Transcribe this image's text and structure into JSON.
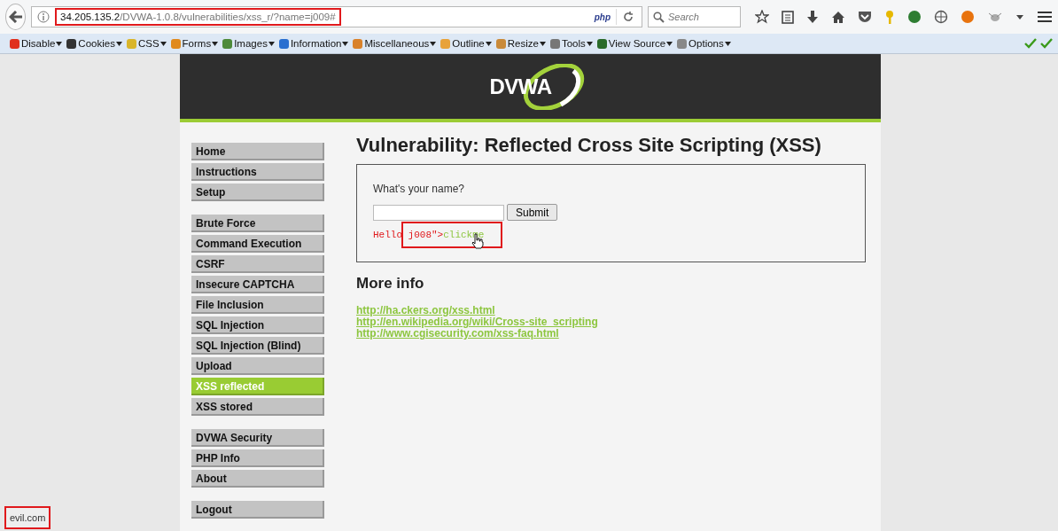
{
  "browser": {
    "url": {
      "host": "34.205.135.2",
      "path": "/DVWA-1.0.8/vulnerabilities/xss_r/?name=j009#",
      "highlighted": true
    },
    "php_badge": "php",
    "search": {
      "placeholder": "Search"
    }
  },
  "devbar": {
    "items": [
      {
        "label": "Disable"
      },
      {
        "label": "Cookies"
      },
      {
        "label": "CSS"
      },
      {
        "label": "Forms"
      },
      {
        "label": "Images"
      },
      {
        "label": "Information"
      },
      {
        "label": "Miscellaneous"
      },
      {
        "label": "Outline"
      },
      {
        "label": "Resize"
      },
      {
        "label": "Tools"
      },
      {
        "label": "View Source"
      },
      {
        "label": "Options"
      }
    ]
  },
  "header": {
    "logo": "DVWA"
  },
  "menu": {
    "groups": [
      [
        {
          "label": "Home",
          "selected": false
        },
        {
          "label": "Instructions",
          "selected": false
        },
        {
          "label": "Setup",
          "selected": false
        }
      ],
      [
        {
          "label": "Brute Force",
          "selected": false
        },
        {
          "label": "Command Execution",
          "selected": false
        },
        {
          "label": "CSRF",
          "selected": false
        },
        {
          "label": "Insecure CAPTCHA",
          "selected": false
        },
        {
          "label": "File Inclusion",
          "selected": false
        },
        {
          "label": "SQL Injection",
          "selected": false
        },
        {
          "label": "SQL Injection (Blind)",
          "selected": false
        },
        {
          "label": "Upload",
          "selected": false
        },
        {
          "label": "XSS reflected",
          "selected": true
        },
        {
          "label": "XSS stored",
          "selected": false
        }
      ],
      [
        {
          "label": "DVWA Security",
          "selected": false
        },
        {
          "label": "PHP Info",
          "selected": false
        },
        {
          "label": "About",
          "selected": false
        }
      ],
      [
        {
          "label": "Logout",
          "selected": false
        }
      ]
    ]
  },
  "main": {
    "title": "Vulnerability: Reflected Cross Site Scripting (XSS)",
    "form": {
      "prompt": "What's your name?",
      "button": "Submit"
    },
    "output": {
      "prefix": "Hello j008\">",
      "link": "clickme",
      "highlighted": true
    },
    "more_info": {
      "heading": "More info",
      "links": [
        "http://ha.ckers.org/xss.html",
        "http://en.wikipedia.org/wiki/Cross-site_scripting",
        "http://www.cgisecurity.com/xss-faq.html"
      ]
    }
  },
  "status": {
    "text": "evil.com",
    "highlighted": true
  }
}
